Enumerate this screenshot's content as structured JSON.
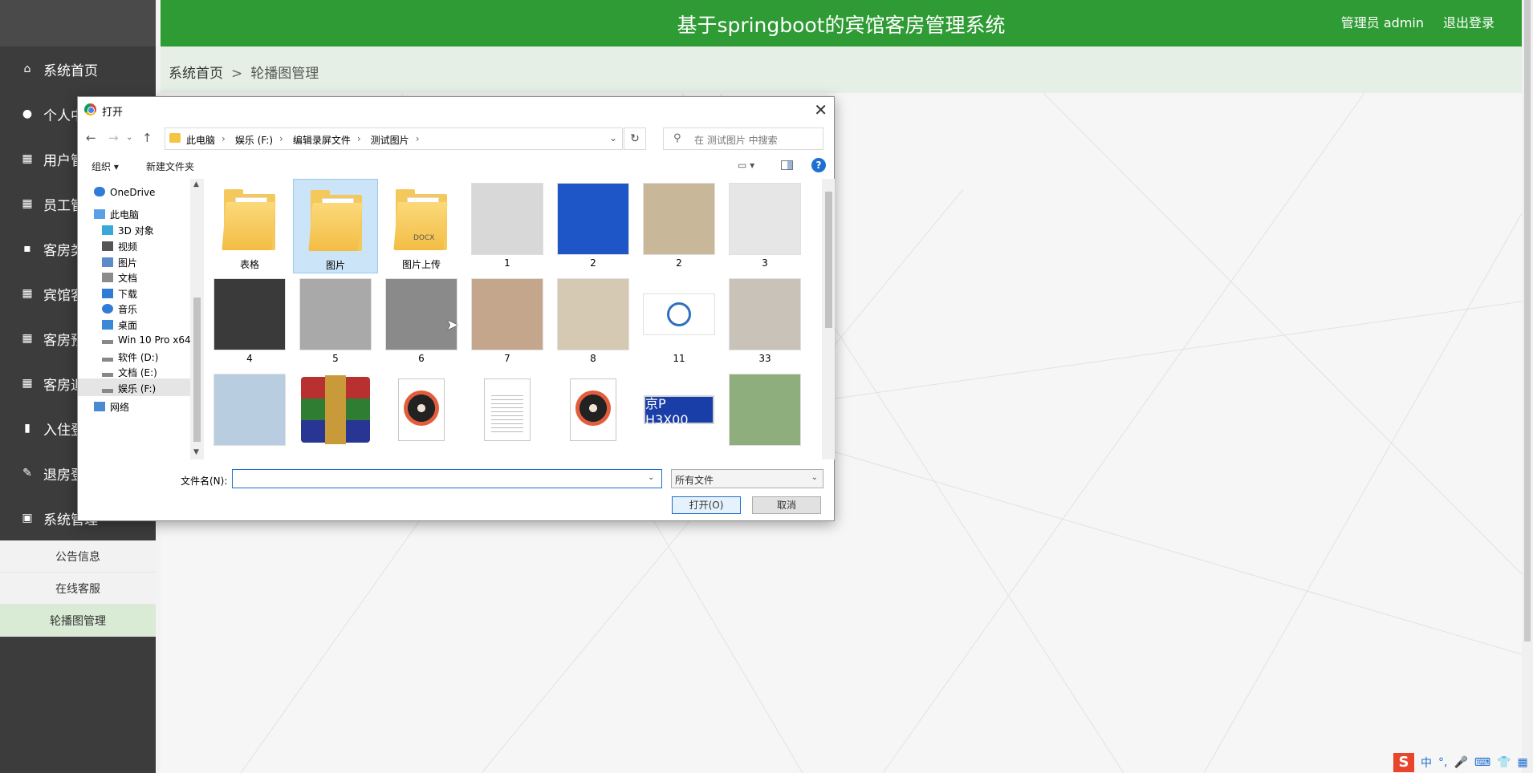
{
  "header": {
    "title": "基于springboot的宾馆客房管理系统",
    "user": "管理员 admin",
    "logout": "退出登录"
  },
  "breadcrumb": {
    "home": "系统首页",
    "sep": ">",
    "current": "轮播图管理"
  },
  "sidebar": {
    "items": [
      {
        "icon": "home-icon",
        "label": "系统首页"
      },
      {
        "icon": "user-icon",
        "label": "个人中心"
      },
      {
        "icon": "grid-icon",
        "label": "用户管理"
      },
      {
        "icon": "grid-icon",
        "label": "员工管理"
      },
      {
        "icon": "chat-icon",
        "label": "客房类型"
      },
      {
        "icon": "grid-icon",
        "label": "宾馆客房"
      },
      {
        "icon": "grid-icon",
        "label": "客房预订"
      },
      {
        "icon": "grid-icon",
        "label": "客房退订"
      },
      {
        "icon": "bar-chart-icon",
        "label": "入住登记"
      },
      {
        "icon": "edit-icon",
        "label": "退房登记"
      },
      {
        "icon": "briefcase-icon",
        "label": "系统管理"
      }
    ],
    "sub_items": [
      {
        "label": "公告信息"
      },
      {
        "label": "在线客服"
      },
      {
        "label": "轮播图管理"
      }
    ]
  },
  "dialog": {
    "title": "打开",
    "address": {
      "segments": [
        "此电脑",
        "娱乐 (F:)",
        "编辑录屏文件",
        "测试图片"
      ]
    },
    "search_placeholder": "在 测试图片 中搜索",
    "toolbar": {
      "organize": "组织 ▾",
      "new_folder": "新建文件夹"
    },
    "nav_items": [
      {
        "label": "OneDrive",
        "icon": "cloud-icon"
      },
      {
        "label": "此电脑",
        "icon": "computer-icon"
      },
      {
        "label": "3D 对象",
        "icon": "cube-icon"
      },
      {
        "label": "视频",
        "icon": "video-icon"
      },
      {
        "label": "图片",
        "icon": "image-icon"
      },
      {
        "label": "文档",
        "icon": "document-icon"
      },
      {
        "label": "下载",
        "icon": "download-icon"
      },
      {
        "label": "音乐",
        "icon": "music-icon"
      },
      {
        "label": "桌面",
        "icon": "desktop-icon"
      },
      {
        "label": "Win 10 Pro x64",
        "icon": "drive-icon"
      },
      {
        "label": "软件 (D:)",
        "icon": "drive-icon"
      },
      {
        "label": "文档 (E:)",
        "icon": "drive-icon"
      },
      {
        "label": "娱乐 (F:)",
        "icon": "drive-icon"
      },
      {
        "label": "网络",
        "icon": "network-icon"
      }
    ],
    "files": [
      {
        "name": "表格",
        "kind": "folder"
      },
      {
        "name": "图片",
        "kind": "folder",
        "selected": true
      },
      {
        "name": "图片上传",
        "kind": "folder-docx"
      },
      {
        "name": "1",
        "kind": "photo",
        "color": "#d8d8d8"
      },
      {
        "name": "2",
        "kind": "photo",
        "color": "#1e56c8"
      },
      {
        "name": "2",
        "kind": "photo",
        "color": "#c9b79a"
      },
      {
        "name": "3",
        "kind": "photo",
        "color": "#e6e6e6"
      },
      {
        "name": "4",
        "kind": "photo",
        "color": "#3a3a3a"
      },
      {
        "name": "5",
        "kind": "photo",
        "color": "#a9a9a9"
      },
      {
        "name": "6",
        "kind": "photo",
        "color": "#8a8a8a"
      },
      {
        "name": "7",
        "kind": "photo",
        "color": "#c4a68c"
      },
      {
        "name": "8",
        "kind": "photo",
        "color": "#d6c9b4"
      },
      {
        "name": "11",
        "kind": "logo",
        "color": "#ffffff"
      },
      {
        "name": "33",
        "kind": "photo",
        "color": "#c8c2b8"
      },
      {
        "name": "",
        "kind": "photo",
        "color": "#b9cde0"
      },
      {
        "name": "",
        "kind": "winrar"
      },
      {
        "name": "",
        "kind": "disc"
      },
      {
        "name": "",
        "kind": "doc"
      },
      {
        "name": "",
        "kind": "disc"
      },
      {
        "name": "",
        "kind": "plate",
        "text": "京P H3X00"
      },
      {
        "name": "",
        "kind": "photo",
        "color": "#8fae7e"
      }
    ],
    "filename_label": "文件名(N):",
    "filename_value": "",
    "filetype": "所有文件",
    "open_button": "打开(O)",
    "cancel_button": "取消"
  },
  "ime": {
    "logo": "S",
    "mode": "中"
  }
}
